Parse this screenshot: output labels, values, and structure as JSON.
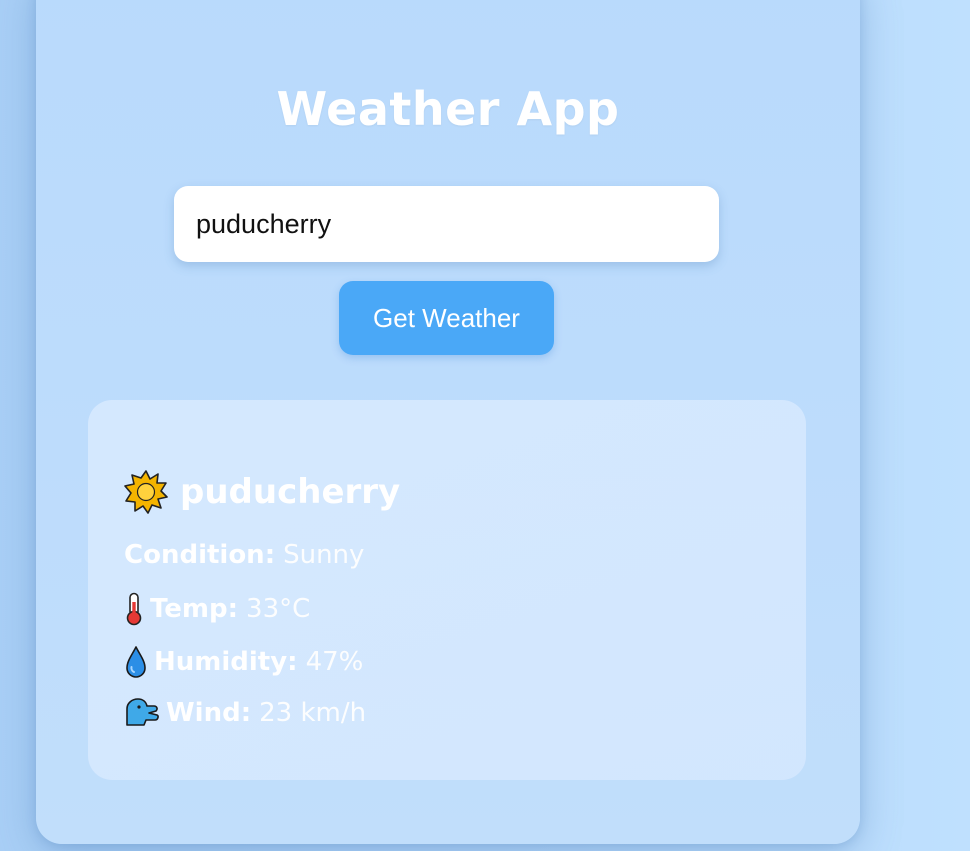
{
  "app": {
    "title": "Weather App"
  },
  "search": {
    "value": "puducherry",
    "button_label": "Get Weather"
  },
  "result": {
    "city": "puducherry",
    "city_icon": "sun-icon",
    "condition": {
      "label": "Condition:",
      "value": "Sunny"
    },
    "temp": {
      "label": "Temp:",
      "value": "33°C",
      "icon": "thermometer-icon"
    },
    "humidity": {
      "label": "Humidity:",
      "value": "47%",
      "icon": "droplet-icon"
    },
    "wind": {
      "label": "Wind:",
      "value": "23 km/h",
      "icon": "wind-face-icon"
    }
  },
  "colors": {
    "accent": "#4aa8f7",
    "background": "#b4d7fb",
    "text": "#ffffff"
  }
}
